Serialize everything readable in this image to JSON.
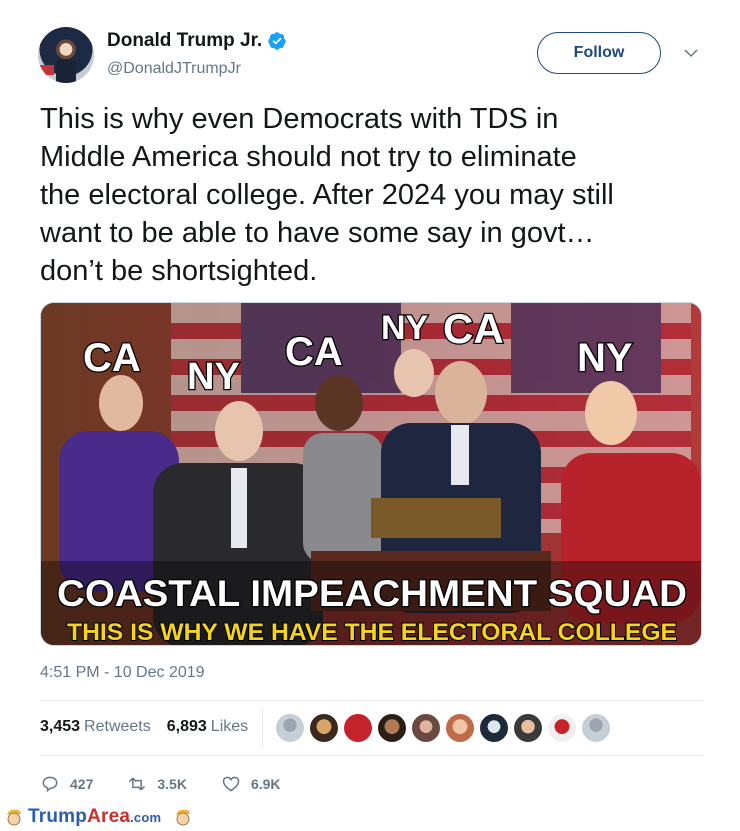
{
  "author": {
    "name": "Donald Trump Jr.",
    "handle": "@DonaldJTrumpJr"
  },
  "follow_label": "Follow",
  "tweet": {
    "text": "This is why even Democrats with TDS in\nMiddle America should not try to eliminate\nthe electoral college. After 2024 you may still\nwant to be able to have some say in govt…\ndon’t be shortsighted.",
    "timestamp": "4:51 PM - 10 Dec 2019"
  },
  "image": {
    "tags": [
      "CA",
      "NY",
      "CA",
      "NY",
      "CA",
      "NY"
    ],
    "headline": "COASTAL IMPEACHMENT SQUAD",
    "subline": "THIS IS WHY WE HAVE THE ELECTORAL COLLEGE"
  },
  "stats": {
    "retweets_count": "3,453",
    "retweets_label": "Retweets",
    "likes_count": "6,893",
    "likes_label": "Likes"
  },
  "actions": {
    "replies": "427",
    "retweets": "3.5K",
    "likes": "6.9K"
  },
  "watermark": {
    "trump": "Trump",
    "area": "Area",
    "com": ".com"
  },
  "colors": {
    "accent": "#1d4a7a",
    "verified": "#1da1f2",
    "muted": "#657786"
  },
  "icons": [
    "verified-badge-icon",
    "chevron-down-icon",
    "reply-icon",
    "retweet-icon",
    "like-icon"
  ]
}
